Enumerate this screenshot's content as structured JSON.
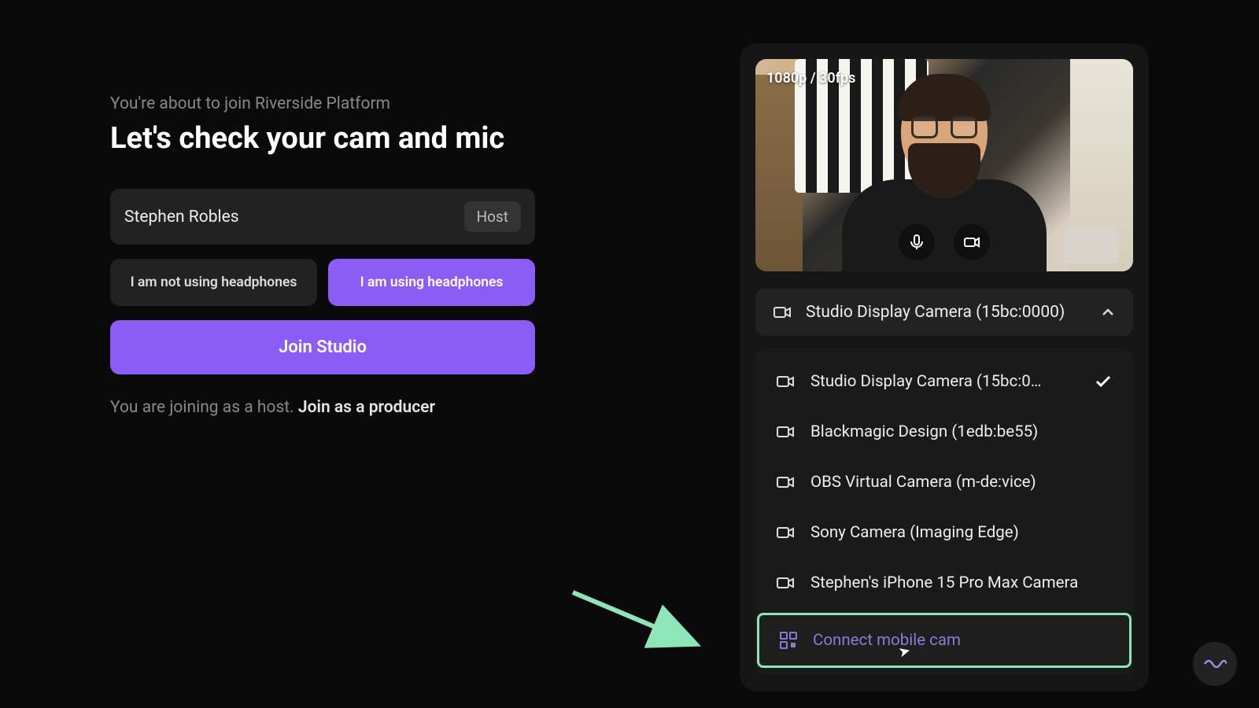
{
  "left": {
    "subtitle": "You're about to join Riverside Platform",
    "title": "Let's check your cam and mic",
    "name_value": "Stephen Robles",
    "role_badge": "Host",
    "hp_no": "I am not using headphones",
    "hp_yes": "I am using headphones",
    "join_btn": "Join Studio",
    "join_hint_prefix": "You are joining as a host. ",
    "join_hint_link": "Join as a producer"
  },
  "preview": {
    "resolution_badge": "1080p / 30fps"
  },
  "camera_select": {
    "selected": "Studio Display Camera (15bc:0000)"
  },
  "camera_options": [
    {
      "label": "Studio Display Camera (15bc:0…",
      "selected": true
    },
    {
      "label": "Blackmagic Design (1edb:be55)",
      "selected": false
    },
    {
      "label": "OBS Virtual Camera (m-de:vice)",
      "selected": false
    },
    {
      "label": "Sony Camera (Imaging Edge)",
      "selected": false
    },
    {
      "label": "Stephen's iPhone 15 Pro Max Camera",
      "selected": false
    }
  ],
  "connect_mobile": "Connect mobile cam",
  "colors": {
    "accent": "#8b5cf6",
    "highlight": "#8ee5b8"
  }
}
